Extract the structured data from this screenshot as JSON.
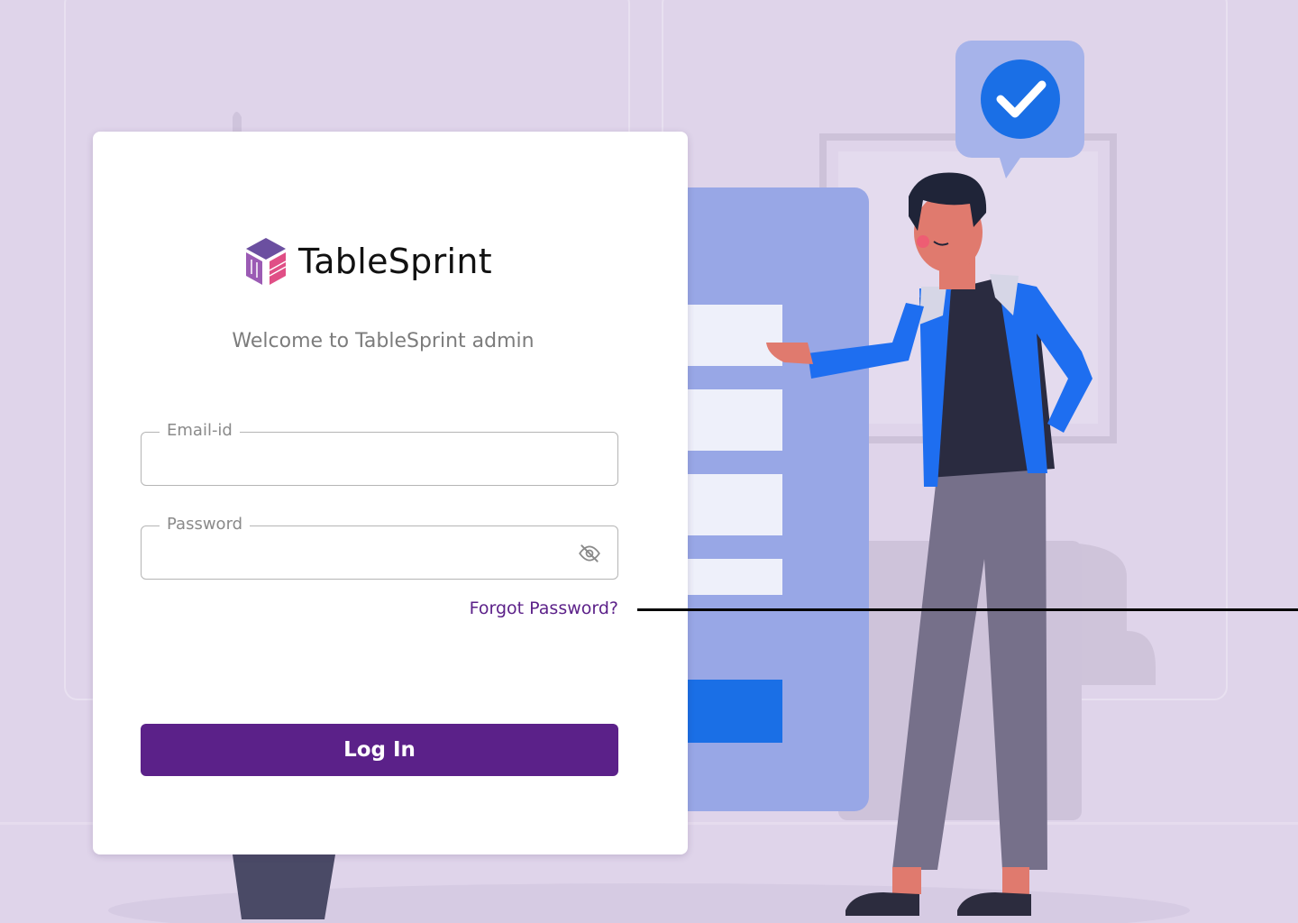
{
  "brand": {
    "name": "TableSprint",
    "logo_icon": "cube-logo-icon"
  },
  "login": {
    "welcome_text": "Welcome to TableSprint admin",
    "email_label": "Email-id",
    "email_value": "",
    "password_label": "Password",
    "password_value": "",
    "password_toggle_icon": "eye-off-icon",
    "forgot_password": "Forgot Password?",
    "submit_label": "Log In"
  },
  "colors": {
    "background": "#dfd4ea",
    "primary": "#5b2189",
    "link": "#5c2189",
    "illustration_blue": "#1a73e8"
  }
}
